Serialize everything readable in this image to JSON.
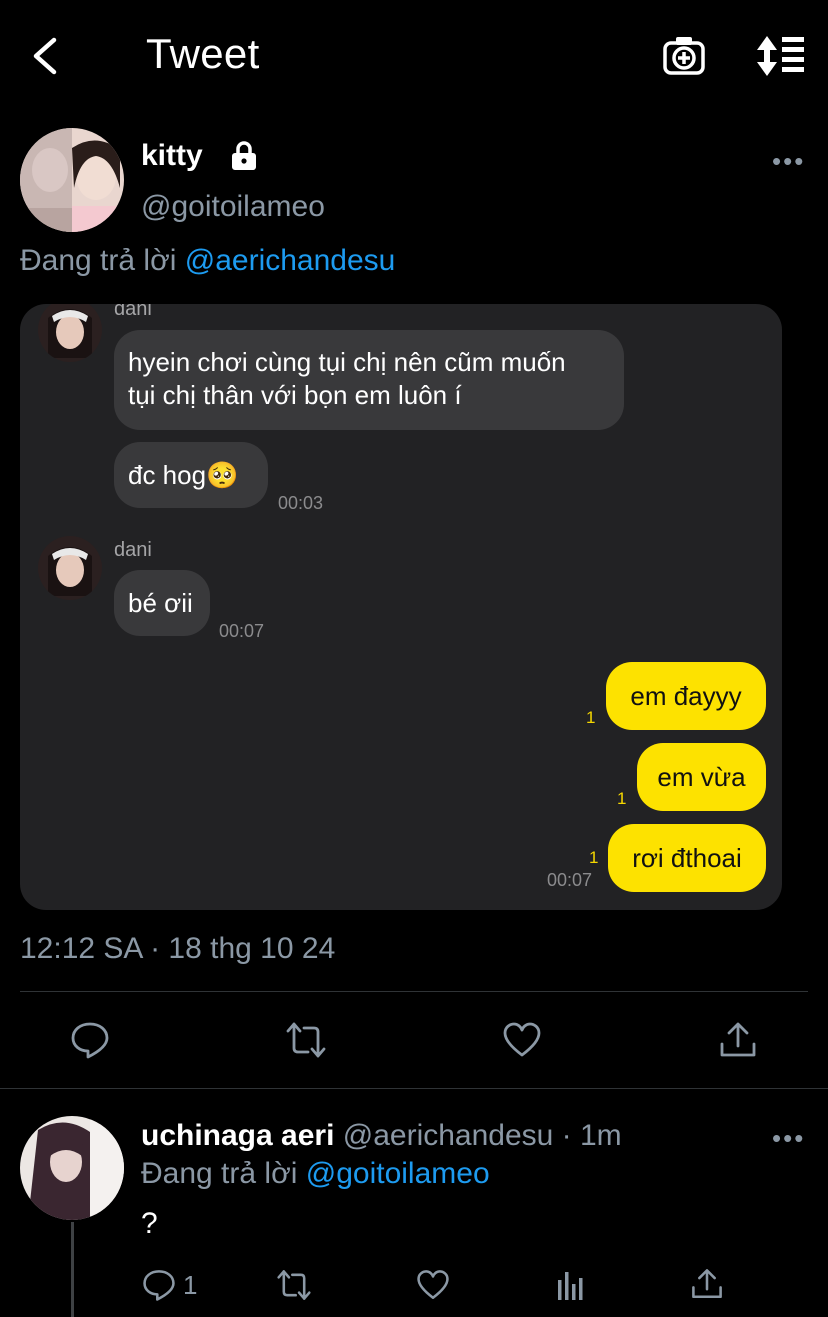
{
  "header": {
    "title": "Tweet"
  },
  "tweet": {
    "name": "kitty",
    "handle": "@goitoilameo",
    "replying_prefix": "Đang trả lời ",
    "replying_to": "@aerichandesu",
    "timestamp": "12:12 SA · 18 thg 10 24"
  },
  "chat": {
    "sender_name": "dani",
    "messages_in_1": {
      "line1": "hyein chơi cùng tụi chị nên cũm muốn",
      "line2": "tụi chị thân với bọn em luôn í"
    },
    "msg_in_2": "đc hog",
    "msg_in_2_emoji": "🥺",
    "time_1": "00:03",
    "sender_name_2": "dani",
    "msg_in_3": "bé ơii",
    "time_2": "00:07",
    "out_1": "em đayyy",
    "out_2": "em vừa",
    "out_3": "rơi đthoai",
    "unread_1": "1",
    "unread_2": "1",
    "unread_3": "1",
    "time_3": "00:07"
  },
  "reply": {
    "name": "uchinaga aeri",
    "handle_time": "@aerichandesu · 1m",
    "replying_prefix": "Đang trả lời ",
    "replying_to": "@goitoilameo",
    "text": "?",
    "reply_count": "1"
  },
  "colors": {
    "accent": "#1d9bf0",
    "bubble_out": "#fde200",
    "secondary_text": "#8b98a5"
  }
}
